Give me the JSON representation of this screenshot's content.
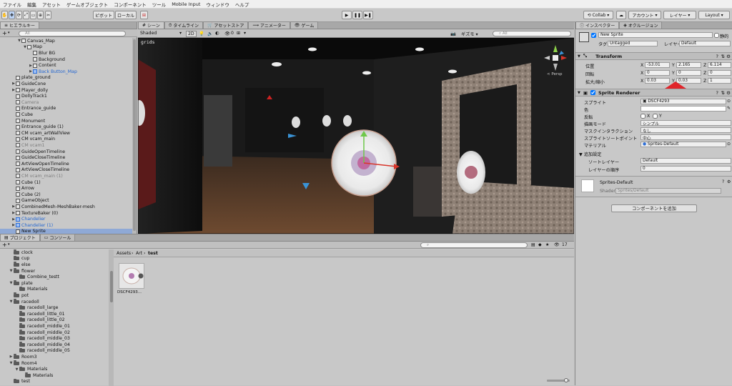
{
  "menubar": {
    "items": [
      "ファイル",
      "編集",
      "アセット",
      "ゲームオブジェクト",
      "コンポーネント",
      "ツール",
      "Mobile Input",
      "ウィンドウ",
      "ヘルプ"
    ]
  },
  "toolbar": {
    "pivot_label": "ピボット",
    "local_label": "ローカル",
    "collab_label": "Collab",
    "account_label": "アカウント",
    "layers_label": "レイヤー",
    "layout_label": "Layout",
    "play_icon": "▶",
    "pause_icon": "❚❚",
    "step_icon": "▶❚"
  },
  "hierarchy": {
    "tab_label": "ヒエラルキー",
    "create_label": "+",
    "search_placeholder": "All",
    "rows": [
      {
        "label": "Canvas_Map",
        "indent": 3,
        "tri": "▼",
        "style": ""
      },
      {
        "label": "Map",
        "indent": 4,
        "tri": "▼",
        "style": ""
      },
      {
        "label": "Blur BG",
        "indent": 5,
        "tri": "",
        "style": ""
      },
      {
        "label": "Background",
        "indent": 5,
        "tri": "",
        "style": ""
      },
      {
        "label": "Content",
        "indent": 5,
        "tri": "▶",
        "style": ""
      },
      {
        "label": "Back Button_Map",
        "indent": 5,
        "tri": "▶",
        "style": "blue"
      },
      {
        "label": "plate_ground",
        "indent": 2,
        "tri": "",
        "style": ""
      },
      {
        "label": "GuideCone",
        "indent": 2,
        "tri": "▶",
        "style": ""
      },
      {
        "label": "Player_dolly",
        "indent": 2,
        "tri": "▶",
        "style": ""
      },
      {
        "label": "DollyTrack1",
        "indent": 2,
        "tri": "",
        "style": ""
      },
      {
        "label": "Camera",
        "indent": 2,
        "tri": "",
        "style": "grey"
      },
      {
        "label": "Entrance_guide",
        "indent": 2,
        "tri": "",
        "style": ""
      },
      {
        "label": "Cube",
        "indent": 2,
        "tri": "",
        "style": ""
      },
      {
        "label": "Monument",
        "indent": 2,
        "tri": "",
        "style": ""
      },
      {
        "label": "Entrance_guide (1)",
        "indent": 2,
        "tri": "",
        "style": ""
      },
      {
        "label": "CM vcam_artWallView",
        "indent": 2,
        "tri": "",
        "style": ""
      },
      {
        "label": "CM vcam_main",
        "indent": 2,
        "tri": "",
        "style": ""
      },
      {
        "label": "CM vcam1",
        "indent": 2,
        "tri": "",
        "style": "grey"
      },
      {
        "label": "GuideOpenTimeline",
        "indent": 2,
        "tri": "",
        "style": ""
      },
      {
        "label": "GuideCloseTimeline",
        "indent": 2,
        "tri": "",
        "style": ""
      },
      {
        "label": "ArtViewOpenTimeline",
        "indent": 2,
        "tri": "",
        "style": ""
      },
      {
        "label": "ArtViewCloseTimeline",
        "indent": 2,
        "tri": "",
        "style": ""
      },
      {
        "label": "CM vcam_main (1)",
        "indent": 2,
        "tri": "",
        "style": "grey"
      },
      {
        "label": "Cube (1)",
        "indent": 2,
        "tri": "",
        "style": ""
      },
      {
        "label": "Arrow",
        "indent": 2,
        "tri": "",
        "style": ""
      },
      {
        "label": "Cube (2)",
        "indent": 2,
        "tri": "",
        "style": ""
      },
      {
        "label": "GameObject",
        "indent": 2,
        "tri": "",
        "style": ""
      },
      {
        "label": "CombinedMesh-MeshBaker-mesh",
        "indent": 2,
        "tri": "▶",
        "style": ""
      },
      {
        "label": "TextureBaker (0)",
        "indent": 2,
        "tri": "▶",
        "style": ""
      },
      {
        "label": "Chandelier",
        "indent": 2,
        "tri": "▶",
        "style": "blue"
      },
      {
        "label": "Chandelier (1)",
        "indent": 2,
        "tri": "▶",
        "style": "blue"
      },
      {
        "label": "New Sprite",
        "indent": 2,
        "tri": "",
        "style": "sel"
      }
    ]
  },
  "scene": {
    "tabs": [
      "シーン",
      "タイムライン",
      "アセットストア",
      "アニメーター",
      "ゲーム"
    ],
    "shading_mode": "Shaded",
    "mode_2d": "2D",
    "gizmos_label": "ギズモ",
    "search_placeholder": "All",
    "layer_counter": "0",
    "grids_label": "grids",
    "persp_label": "< Persp",
    "gizmo_axes": {
      "y": "y",
      "z": "z",
      "x": "x"
    }
  },
  "inspector": {
    "tabs": [
      "インスペクター",
      "オクルージョン"
    ],
    "object_name": "New Sprite",
    "static_label": "静的",
    "tag_label": "タグ",
    "tag_value": "Untagged",
    "layer_label": "レイヤー",
    "layer_value": "Default",
    "transform": {
      "title": "Transform",
      "position_label": "位置",
      "rotation_label": "回転",
      "scale_label": "拡大/縮小",
      "position": {
        "x": "-53.01",
        "y": "2.165",
        "z": "6.114"
      },
      "rotation": {
        "x": "0",
        "y": "0",
        "z": "0"
      },
      "scale": {
        "x": "0.03",
        "y": "0.03",
        "z": "1"
      }
    },
    "sprite_renderer": {
      "title": "Sprite Renderer",
      "sprite_label": "スプライト",
      "sprite_value": "DSCF4293",
      "color_label": "色",
      "flip_label": "反転",
      "flip_x": "X",
      "flip_y": "Y",
      "draw_mode_label": "描画モード",
      "draw_mode_value": "シンプル",
      "mask_label": "マスクインタラクション",
      "mask_value": "なし",
      "sort_point_label": "スプライトソートポイント",
      "sort_point_value": "中心",
      "material_label": "マテリアル",
      "material_value": "Sprites-Default",
      "additional_label": "追加設定",
      "sorting_layer_label": "ソートレイヤー",
      "sorting_layer_value": "Default",
      "order_label": "レイヤーの順序",
      "order_value": "0"
    },
    "material": {
      "name": "Sprites-Default",
      "shader_label": "Shader",
      "shader_value": "Sprites/Default"
    },
    "add_component_label": "コンポーネントを追加",
    "accent_color": "#e0242a"
  },
  "project": {
    "tabs": [
      "プロジェクト",
      "コンソール"
    ],
    "create_label": "+",
    "breadcrumb": [
      "Assets",
      "Art",
      "test"
    ],
    "badge_count": "17",
    "folders": [
      {
        "label": "clock",
        "indent": 1,
        "tri": ""
      },
      {
        "label": "cup",
        "indent": 1,
        "tri": ""
      },
      {
        "label": "else",
        "indent": 1,
        "tri": ""
      },
      {
        "label": "flower",
        "indent": 1,
        "tri": "▼"
      },
      {
        "label": "Combine_testt",
        "indent": 2,
        "tri": ""
      },
      {
        "label": "plate",
        "indent": 1,
        "tri": "▼"
      },
      {
        "label": "Materials",
        "indent": 2,
        "tri": ""
      },
      {
        "label": "pot",
        "indent": 1,
        "tri": ""
      },
      {
        "label": "racedoll",
        "indent": 1,
        "tri": "▼"
      },
      {
        "label": "racedoll_large",
        "indent": 2,
        "tri": ""
      },
      {
        "label": "racedoll_little_01",
        "indent": 2,
        "tri": ""
      },
      {
        "label": "racedoll_little_02",
        "indent": 2,
        "tri": ""
      },
      {
        "label": "racedoll_middle_01",
        "indent": 2,
        "tri": ""
      },
      {
        "label": "racedoll_middle_02",
        "indent": 2,
        "tri": ""
      },
      {
        "label": "racedoll_middle_03",
        "indent": 2,
        "tri": ""
      },
      {
        "label": "racedoll_middle_04",
        "indent": 2,
        "tri": ""
      },
      {
        "label": "racedoll_middle_05",
        "indent": 2,
        "tri": ""
      },
      {
        "label": "Room3",
        "indent": 1,
        "tri": "▶"
      },
      {
        "label": "Room4",
        "indent": 1,
        "tri": "▼"
      },
      {
        "label": "Materials",
        "indent": 2,
        "tri": "▼"
      },
      {
        "label": "Materials",
        "indent": 3,
        "tri": ""
      },
      {
        "label": "test",
        "indent": 1,
        "tri": ""
      }
    ],
    "asset_label": "DSCF4293..."
  }
}
